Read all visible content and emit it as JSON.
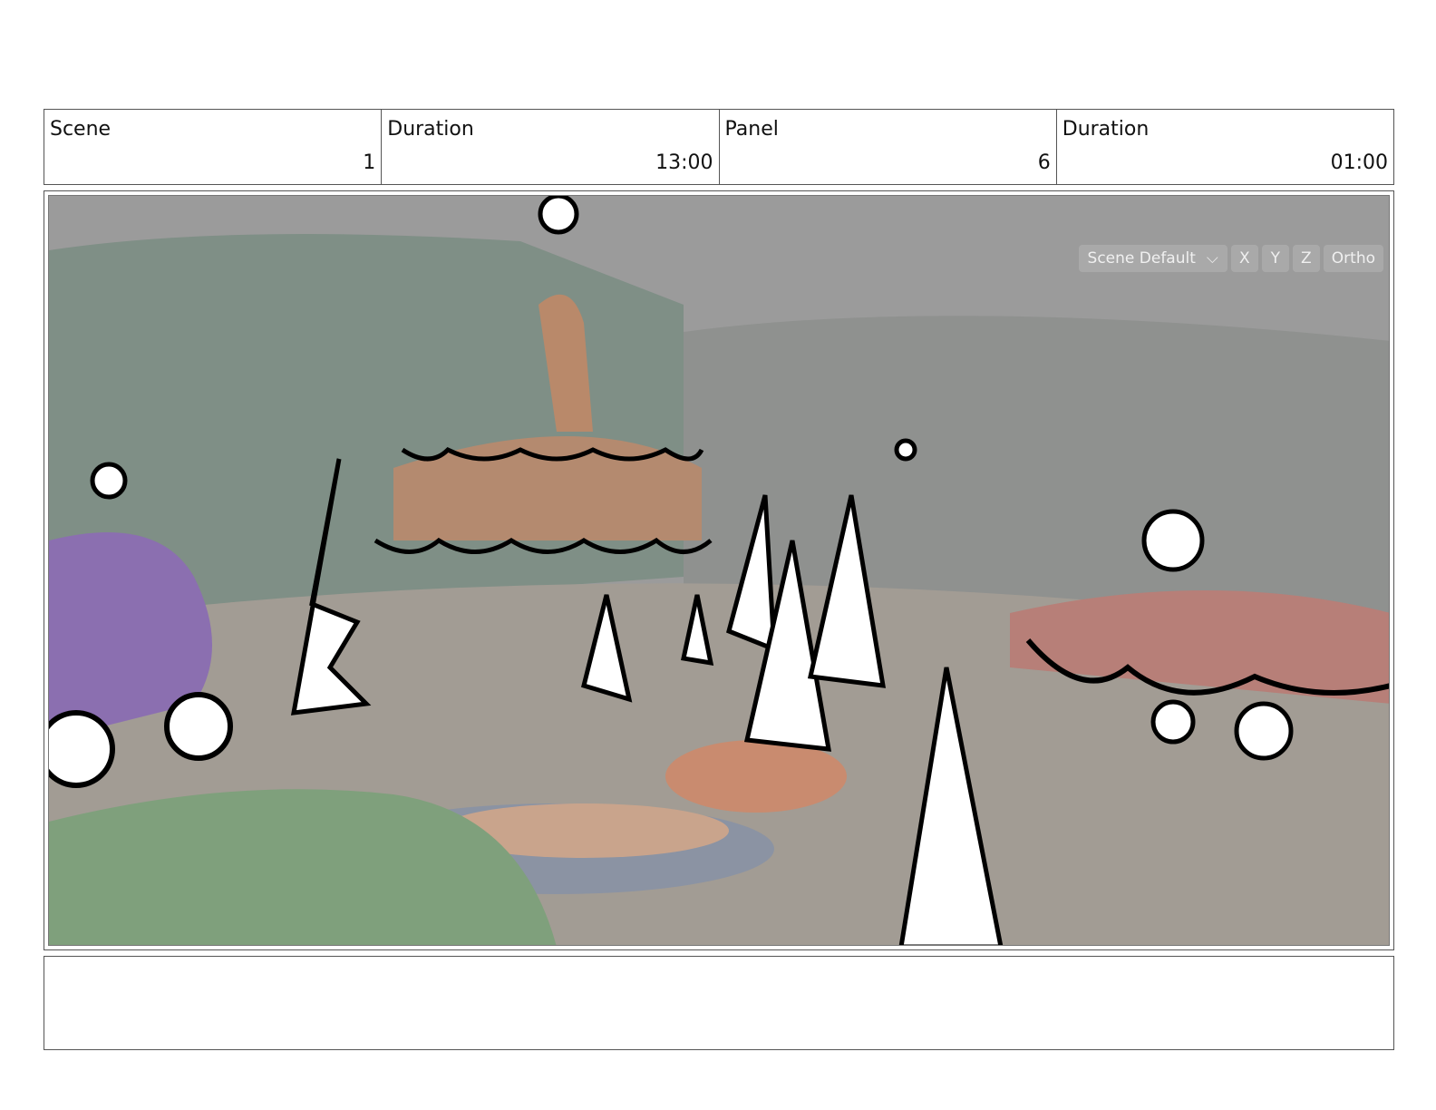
{
  "header": {
    "scene_label": "Scene",
    "scene_value": "1",
    "scene_duration_label": "Duration",
    "scene_duration_value": "13:00",
    "panel_label": "Panel",
    "panel_value": "6",
    "panel_duration_label": "Duration",
    "panel_duration_value": "01:00"
  },
  "viewport_toolbar": {
    "camera_select": "Scene Default",
    "axis_x": "X",
    "axis_y": "Y",
    "axis_z": "Z",
    "ortho": "Ortho",
    "dropdown_icon": "chevron-down-icon"
  },
  "notes": {
    "text": ""
  },
  "colors": {
    "viewport_bg": "#9a9a9a",
    "toolbar_bg": "#a9a9a9"
  }
}
